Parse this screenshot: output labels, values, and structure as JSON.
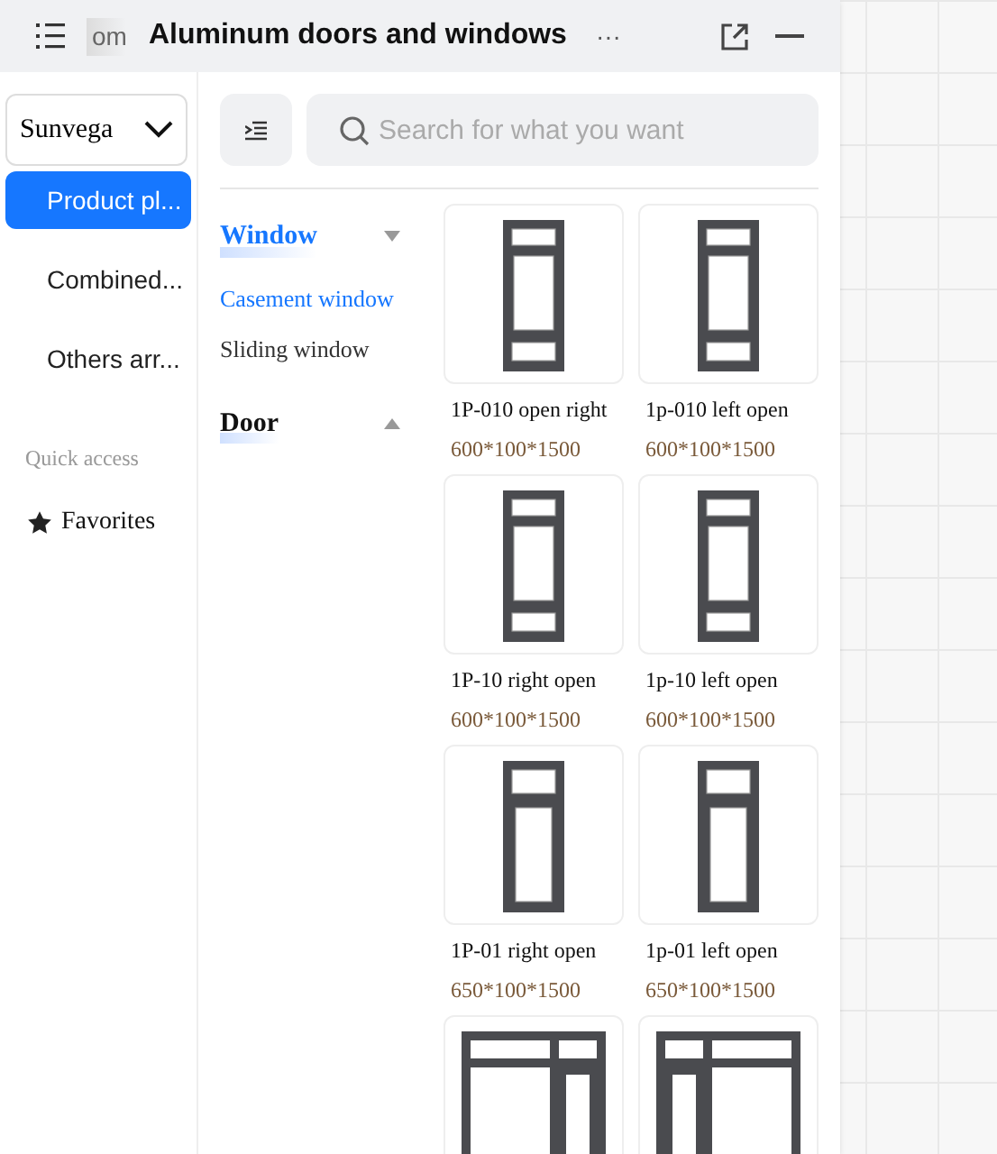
{
  "header": {
    "prev_tab": "om",
    "title": "Aluminum doors and windows",
    "more": "···"
  },
  "sidebar": {
    "select": "Sunvega",
    "items": [
      {
        "label": "Product pl...",
        "selected": true
      },
      {
        "label": "Combined...",
        "selected": false
      },
      {
        "label": "Others arr...",
        "selected": false
      }
    ],
    "section_label": "Quick access",
    "favorites": "Favorites"
  },
  "search": {
    "placeholder": "Search for what you want"
  },
  "categories": [
    {
      "label": "Window",
      "expanded": true,
      "children": [
        {
          "label": "Casement window",
          "selected": true
        },
        {
          "label": "Sliding window",
          "selected": false
        }
      ]
    },
    {
      "label": "Door",
      "expanded": false
    }
  ],
  "products": [
    {
      "kind": "transom-both",
      "name": "1P-010 open right",
      "size": "600*100*1500"
    },
    {
      "kind": "transom-both",
      "name": "1p-010 left open",
      "size": "600*100*1500"
    },
    {
      "kind": "transom-both",
      "name": "1P-10 right open",
      "size": "600*100*1500"
    },
    {
      "kind": "transom-both",
      "name": "1p-10 left open",
      "size": "600*100*1500"
    },
    {
      "kind": "transom-top",
      "name": "1P-01 right open",
      "size": "650*100*1500"
    },
    {
      "kind": "transom-top",
      "name": "1p-01 left open",
      "size": "650*100*1500"
    },
    {
      "kind": "wide-right"
    },
    {
      "kind": "wide-left"
    }
  ]
}
